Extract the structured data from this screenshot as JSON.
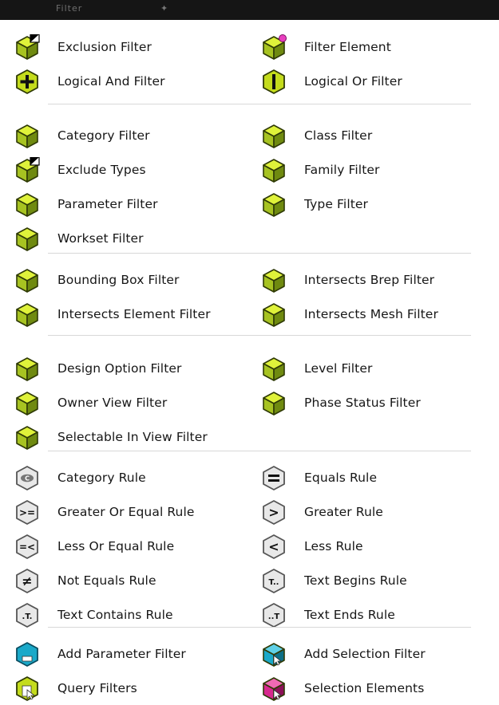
{
  "window": {
    "title": "Filter"
  },
  "groups": [
    {
      "left": [
        {
          "label": "Exclusion Filter",
          "icon": "cube-corner-flag"
        },
        {
          "label": "Logical And Filter",
          "icon": "plus-hex"
        }
      ],
      "right": [
        {
          "label": "Filter Element",
          "icon": "cube-pink-dot"
        },
        {
          "label": "Logical Or Filter",
          "icon": "bar-hex"
        }
      ]
    },
    {
      "left": [
        {
          "label": "Category Filter",
          "icon": "cube"
        },
        {
          "label": "Exclude Types",
          "icon": "cube-corner-flag"
        },
        {
          "label": "Parameter Filter",
          "icon": "cube"
        },
        {
          "label": "Workset Filter",
          "icon": "cube"
        }
      ],
      "right": [
        {
          "label": "Class Filter",
          "icon": "cube"
        },
        {
          "label": "Family Filter",
          "icon": "cube"
        },
        {
          "label": "Type Filter",
          "icon": "cube"
        }
      ]
    },
    {
      "left": [
        {
          "label": "Bounding Box Filter",
          "icon": "cube"
        },
        {
          "label": "Intersects Element Filter",
          "icon": "cube"
        }
      ],
      "right": [
        {
          "label": "Intersects Brep Filter",
          "icon": "cube"
        },
        {
          "label": "Intersects Mesh Filter",
          "icon": "cube"
        }
      ]
    },
    {
      "left": [
        {
          "label": "Design Option Filter",
          "icon": "cube"
        },
        {
          "label": "Owner View Filter",
          "icon": "cube"
        },
        {
          "label": "Selectable In View Filter",
          "icon": "cube"
        }
      ],
      "right": [
        {
          "label": "Level Filter",
          "icon": "cube"
        },
        {
          "label": "Phase Status Filter",
          "icon": "cube"
        }
      ]
    },
    {
      "left": [
        {
          "label": "Category Rule",
          "icon": "category-rule-hex",
          "glyph": "C"
        },
        {
          "label": "Greater Or Equal Rule",
          "icon": "greater-equal-hex",
          "glyph": ">="
        },
        {
          "label": "Less Or Equal Rule",
          "icon": "less-equal-hex",
          "glyph": "=<"
        },
        {
          "label": "Not Equals Rule",
          "icon": "not-equal-hex",
          "glyph": "≠"
        },
        {
          "label": "Text Contains Rule",
          "icon": "text-contains-hex",
          "glyph": ".T."
        }
      ],
      "right": [
        {
          "label": "Equals Rule",
          "icon": "equals-hex",
          "glyph": "="
        },
        {
          "label": "Greater Rule",
          "icon": "greater-hex",
          "glyph": ">"
        },
        {
          "label": "Less Rule",
          "icon": "less-hex",
          "glyph": "<"
        },
        {
          "label": "Text Begins Rule",
          "icon": "text-begins-hex",
          "glyph": "T.."
        },
        {
          "label": "Text Ends Rule",
          "icon": "text-ends-hex",
          "glyph": "..T"
        }
      ]
    },
    {
      "left": [
        {
          "label": "Add Parameter Filter",
          "icon": "cyan-hex-parameter"
        },
        {
          "label": "Query Filters",
          "icon": "yellow-hex-query"
        }
      ],
      "right": [
        {
          "label": "Add Selection Filter",
          "icon": "cyan-cube-cursor"
        },
        {
          "label": "Selection Elements",
          "icon": "magenta-cube-cursor"
        }
      ]
    }
  ],
  "colors": {
    "cube_top": "#dff23a",
    "cube_left": "#a7c321",
    "cube_right": "#6f8a10",
    "outline": "#2f3a06",
    "hex_green": "#c4dc1c",
    "rule_grey": "#e8e8e8",
    "cyan": "#1aa9c9",
    "magenta": "#d7288e",
    "pink_dot": "#e83fbf"
  }
}
